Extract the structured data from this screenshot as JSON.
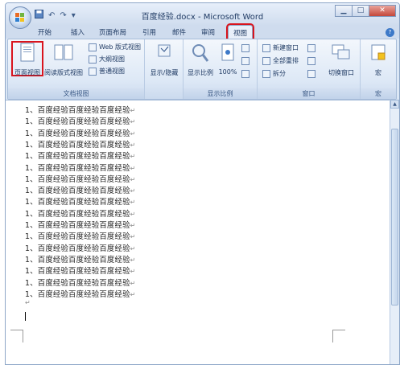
{
  "window": {
    "title": "百度经验.docx - Microsoft Word",
    "minimize_icon": "minimize-icon",
    "maximize_icon": "maximize-icon",
    "close_icon": "close-icon"
  },
  "qat": {
    "save_icon": "save-icon",
    "undo_icon": "undo-icon",
    "redo_icon": "redo-icon",
    "customize_icon": "customize-icon"
  },
  "tabs": [
    {
      "label": "开始"
    },
    {
      "label": "插入"
    },
    {
      "label": "页面布局"
    },
    {
      "label": "引用"
    },
    {
      "label": "邮件"
    },
    {
      "label": "审阅"
    },
    {
      "label": "视图"
    }
  ],
  "ribbon": {
    "doc_views": {
      "label": "文档视图",
      "print_layout": "页面视图",
      "full_screen_reading": "阅读版式视图",
      "web_layout": "Web 版式视图",
      "outline": "大纲视图",
      "draft": "普通视图"
    },
    "show_hide": {
      "label": "显示/隐藏"
    },
    "zoom": {
      "label": "显示比例",
      "zoom": "显示比例",
      "hundred": "100%"
    },
    "window": {
      "label": "窗口",
      "new_window": "新建窗口",
      "arrange_all": "全部重排",
      "split": "拆分",
      "switch_windows": "切换窗口"
    },
    "macros": {
      "label": "宏",
      "macros": "宏"
    }
  },
  "document": {
    "lines": [
      "1、百度经验百度经验百度经验",
      "1、百度经验百度经验百度经验",
      "1、百度经验百度经验百度经验",
      "1、百度经验百度经验百度经验",
      "1、百度经验百度经验百度经验",
      "1、百度经验百度经验百度经验",
      "1、百度经验百度经验百度经验",
      "1、百度经验百度经验百度经验",
      "1、百度经验百度经验百度经验",
      "1、百度经验百度经验百度经验",
      "1、百度经验百度经验百度经验",
      "1、百度经验百度经验百度经验",
      "1、百度经验百度经验百度经验",
      "1、百度经验百度经验百度经验",
      "1、百度经验百度经验百度经验",
      "1、百度经验百度经验百度经验",
      "1、百度经验百度经验百度经验"
    ],
    "paragraph_mark": "↵"
  },
  "colors": {
    "highlight": "#d9141d",
    "ribbon_bg": "#dde8f6",
    "title_bg": "#cfdcee"
  }
}
